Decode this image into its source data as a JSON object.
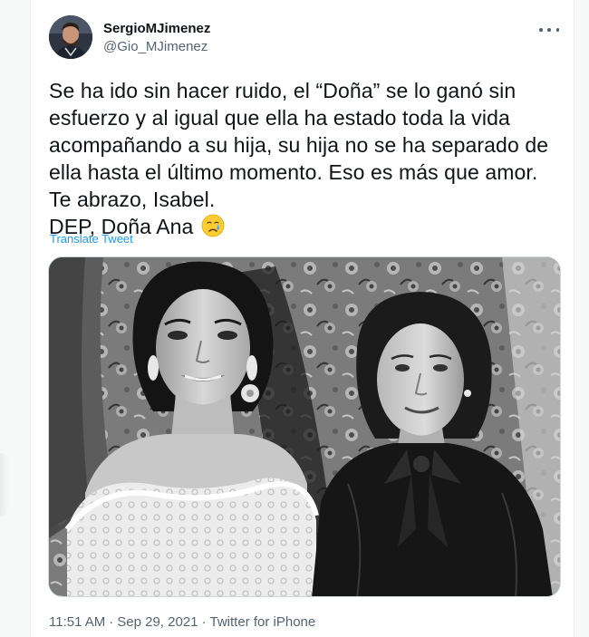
{
  "author": {
    "display_name": "SergioMJimenez",
    "handle": "@Gio_MJimenez"
  },
  "menu": {
    "icon": "more-horizontal-icon"
  },
  "tweet": {
    "lines": [
      "Se ha ido sin hacer ruido, el “Doña” se lo ganó sin",
      "esfuerzo y al igual que ella ha estado toda la vida",
      "acompañando a su hija, su hija no se ha separado de",
      "ella hasta el último momento. Eso es más que amor.",
      "Te abrazo, Isabel.",
      "DEP, Doña Ana"
    ],
    "emoji": "crying-face-emoji",
    "translate_label": "Translate Tweet"
  },
  "media": {
    "type": "black-and-white photo of two women"
  },
  "meta": {
    "time": "11:51 AM",
    "date": "Sep 29, 2021",
    "source": "Twitter for iPhone",
    "separator": "·"
  },
  "colors": {
    "link": "#1d9bf0",
    "text": "#0f1419",
    "secondary": "#536471"
  }
}
